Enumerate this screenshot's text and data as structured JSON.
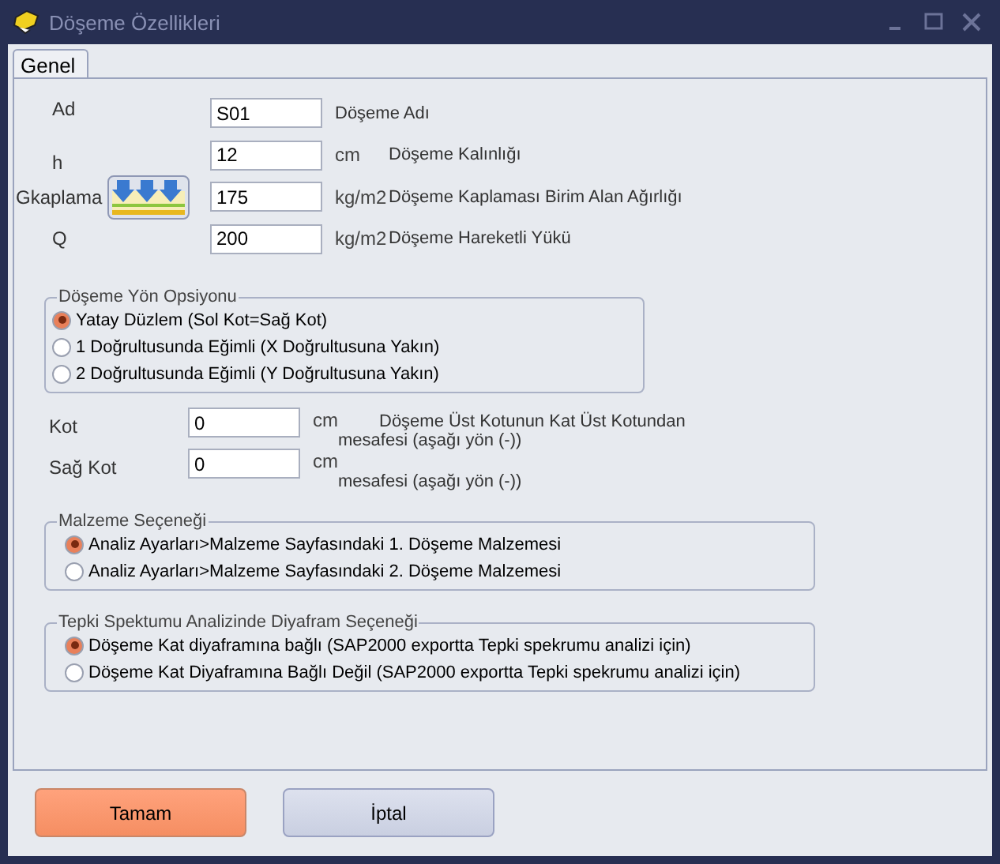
{
  "window": {
    "title": "Döşeme Özellikleri"
  },
  "tabs": [
    {
      "label": "Genel",
      "selected": true
    }
  ],
  "fields": [
    {
      "kind": "plain",
      "label": "Ad",
      "value": "S01",
      "description": "Döşeme Adı"
    },
    {
      "kind": "plain",
      "label": "h",
      "value": "12",
      "unit": "cm",
      "description": "Döşeme Kalınlığı"
    },
    {
      "kind": "with_button",
      "label": "Gkaplama",
      "value": "175",
      "unit": "kg/m2",
      "description": "Döşeme Kaplaması Birim Alan Ağırlığı"
    },
    {
      "kind": "plain",
      "label": "Q",
      "value": "200",
      "unit": "kg/m2",
      "description": "Döşeme Hareketli Yükü"
    }
  ],
  "direction_group": {
    "title": "Döşeme Yön Opsiyonu",
    "options": [
      {
        "label": "Yatay Düzlem (Sol Kot=Sağ Kot)",
        "selected": true
      },
      {
        "label": "1 Doğrultusunda Eğimli (X Doğrultusuna Yakın)",
        "selected": false
      },
      {
        "label": "2 Doğrultusunda Eğimli (Y Doğrultusuna Yakın)",
        "selected": false
      }
    ]
  },
  "elevations": [
    {
      "label": "Kot",
      "value": "0",
      "unit": "cm",
      "note_lines": [
        "Döşeme Üst Kotunun Kat Üst Kotundan",
        "mesafesi (aşağı yön (-))"
      ]
    },
    {
      "label": "Sağ Kot",
      "value": "0",
      "unit": "cm",
      "note_lines": [
        "mesafesi (aşağı yön (-))"
      ]
    }
  ],
  "option_groups": [
    {
      "title": "Malzeme Seçeneği",
      "options": [
        {
          "label": "Analiz Ayarları>Malzeme Sayfasındaki 1. Döşeme Malzemesi",
          "selected": true
        },
        {
          "label": "Analiz Ayarları>Malzeme Sayfasındaki 2. Döşeme Malzemesi",
          "selected": false
        }
      ]
    },
    {
      "title": "Tepki Spektumu Analizinde Diyafram Seçeneği",
      "options": [
        {
          "label": "Döşeme Kat diyaframına bağlı  (SAP2000 exportta Tepki spekrumu analizi için)",
          "selected": true
        },
        {
          "label": "Döşeme Kat Diyaframına Bağlı Değil  (SAP2000 exportta Tepki spekrumu analizi için)",
          "selected": false
        }
      ]
    }
  ],
  "buttons": [
    {
      "label": "Tamam",
      "kind": "primary"
    },
    {
      "label": "İptal",
      "kind": "secondary"
    }
  ]
}
